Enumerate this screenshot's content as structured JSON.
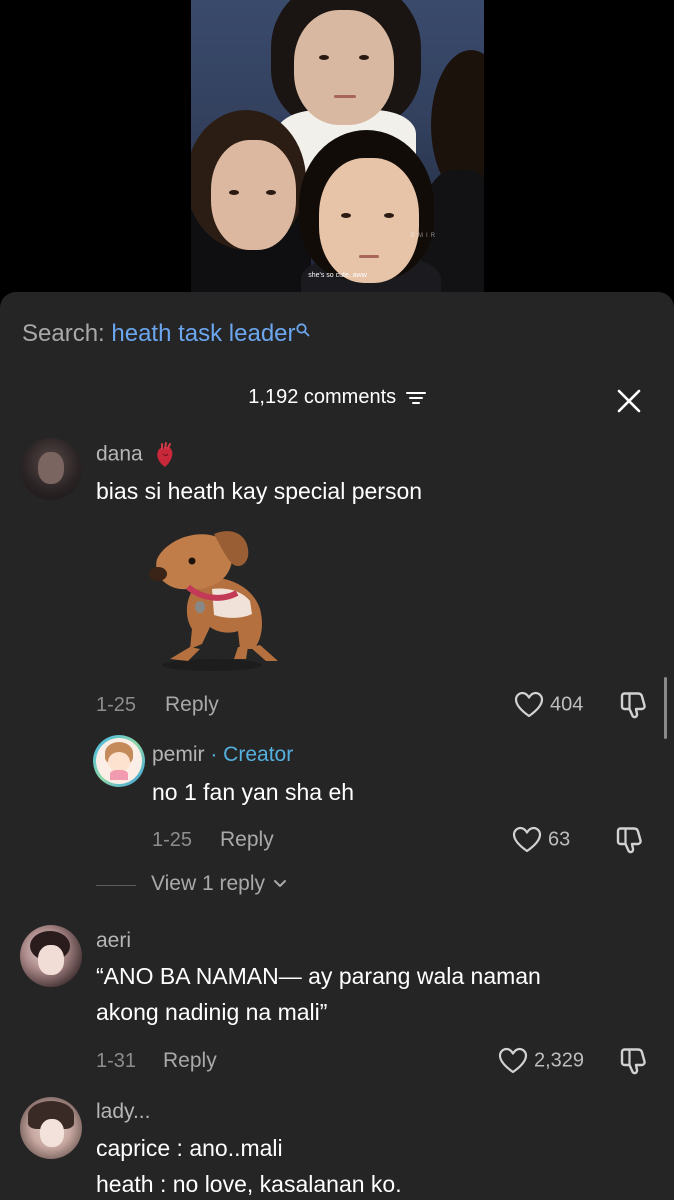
{
  "video": {
    "subtitle": "she's so cute, aww",
    "watermark": "EMIR"
  },
  "search": {
    "prefix": "Search:",
    "term": "heath task leader"
  },
  "header": {
    "comment_count": "1,192 comments"
  },
  "comments": [
    {
      "username": "dana",
      "badge_icon": "anatomical-heart-icon",
      "text": "bias si heath kay special person",
      "sticker": "dachshund-dog-sticker",
      "date": "1-25",
      "reply_label": "Reply",
      "likes": "404"
    },
    {
      "username": "pemir",
      "creator_label": "· Creator",
      "text": "no 1 fan yan sha eh",
      "date": "1-25",
      "reply_label": "Reply",
      "likes": "63"
    },
    {
      "username": "aeri",
      "text_line1": "“ANO BA NAMAN— ay parang wala naman",
      "text_line2": "akong nadinig na mali”",
      "date": "1-31",
      "reply_label": "Reply",
      "likes": "2,329"
    },
    {
      "username": "lady...",
      "text_line1": "caprice : ano..mali",
      "text_line2": "heath : no love, kasalanan ko."
    }
  ],
  "view_replies": "View 1 reply",
  "colors": {
    "panel_bg": "#252525",
    "search_term": "#6ba6ee",
    "creator": "#55b0df"
  }
}
